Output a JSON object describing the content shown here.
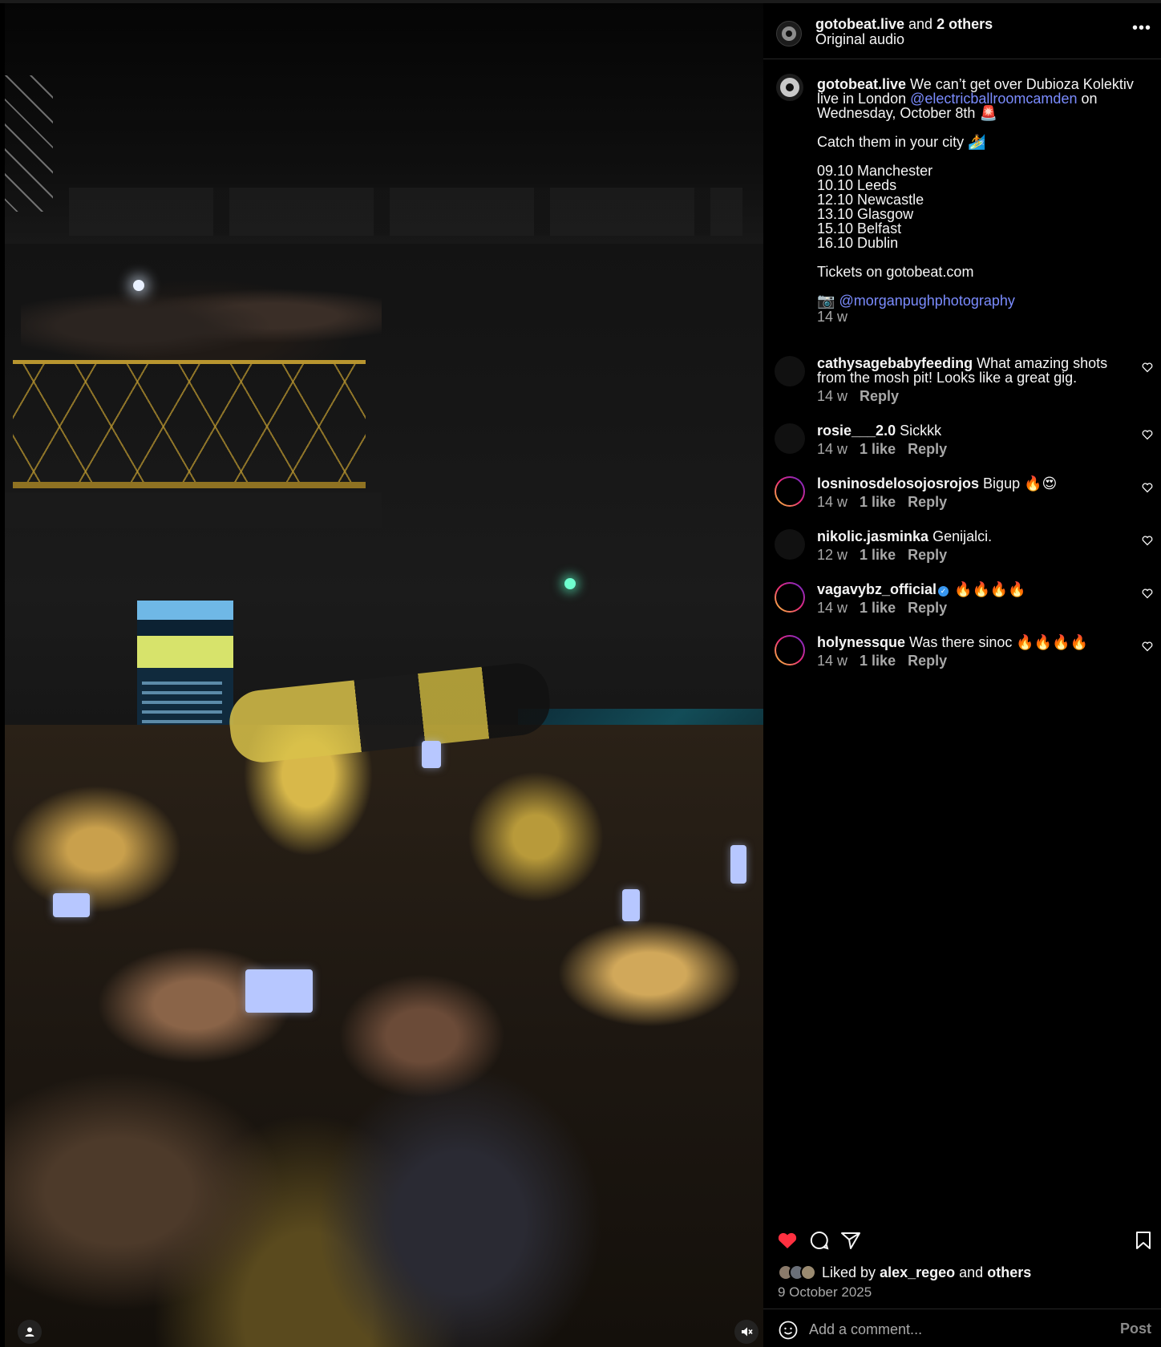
{
  "header": {
    "account": "gotobeat.live",
    "and_text": "and",
    "others": "2 others",
    "audio": "Original audio"
  },
  "caption": {
    "username": "gotobeat.live",
    "line1": "We can’t get over Dubioza Kolektiv live in London",
    "mention1": "@electricballroomcamden",
    "line2": "on Wednesday, October 8th 🚨",
    "catch": "Catch them in your city 🏄",
    "dates": [
      "09.10 Manchester",
      "10.10 Leeds",
      "12.10 Newcastle",
      "13.10 Glasgow",
      "15.10 Belfast",
      "16.10 Dublin"
    ],
    "tickets": "Tickets on gotobeat.com",
    "camera": "📷",
    "credit": "@morganpughphotography",
    "time": "14 w"
  },
  "comments": [
    {
      "username": "cathysagebabyfeeding",
      "text": "What amazing shots from the mosh pit! Looks like a great gig.",
      "time": "14 w",
      "likes": "",
      "reply": "Reply"
    },
    {
      "username": "rosie___2.0",
      "text": "Sickkk",
      "time": "14 w",
      "likes": "1 like",
      "reply": "Reply"
    },
    {
      "username": "losninosdelosojosrojos",
      "text": "Bigup 🔥😍",
      "time": "14 w",
      "likes": "1 like",
      "reply": "Reply"
    },
    {
      "username": "nikolic.jasminka",
      "text": "Genijalci.",
      "time": "12 w",
      "likes": "1 like",
      "reply": "Reply"
    },
    {
      "username": "vagavybz_official",
      "text": "🔥🔥🔥🔥",
      "time": "14 w",
      "likes": "1 like",
      "reply": "Reply"
    },
    {
      "username": "holynessque",
      "text": "Was there sinoc 🔥🔥🔥🔥",
      "time": "14 w",
      "likes": "1 like",
      "reply": "Reply"
    }
  ],
  "likes": {
    "prefix": "Liked by",
    "user": "alex_regeo",
    "and": "and",
    "others": "others"
  },
  "date": "9 October 2025",
  "comment_box": {
    "placeholder": "Add a comment...",
    "post_label": "Post"
  },
  "icons": {
    "more": "more-options-icon",
    "like": "heart-filled-icon",
    "comment": "comment-icon",
    "share": "share-icon",
    "save": "bookmark-icon",
    "emoji": "emoji-icon",
    "user": "user-icon",
    "mute": "muted-icon"
  },
  "colors": {
    "like_red": "#ff3040",
    "mention_blue": "#7b8cff",
    "muted_text": "#a8a8a8",
    "verified": "#3897f0"
  }
}
